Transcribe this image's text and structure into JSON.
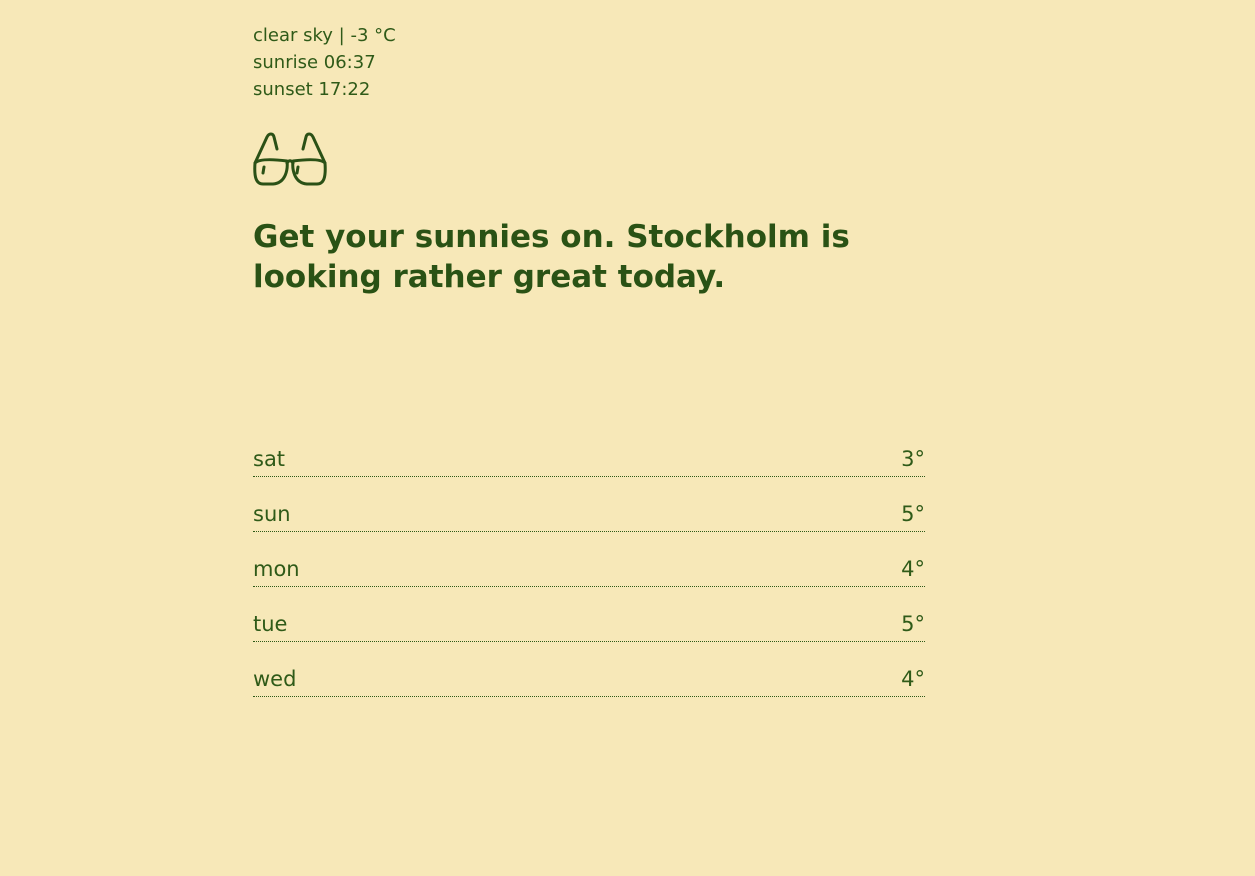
{
  "summary": {
    "condition_line": "clear sky | -3 °C",
    "sunrise_line": "sunrise 06:37",
    "sunset_line": "sunset 17:22"
  },
  "icon": {
    "name": "sunglasses-icon",
    "color": "#2b5116"
  },
  "headline": "Get your sunnies on. Stockholm is looking rather great today.",
  "forecast": [
    {
      "day": "sat",
      "temp": "3°"
    },
    {
      "day": "sun",
      "temp": "5°"
    },
    {
      "day": "mon",
      "temp": "4°"
    },
    {
      "day": "tue",
      "temp": "5°"
    },
    {
      "day": "wed",
      "temp": "4°"
    }
  ],
  "colors": {
    "background": "#f7e8b8",
    "text": "#2b5116"
  }
}
